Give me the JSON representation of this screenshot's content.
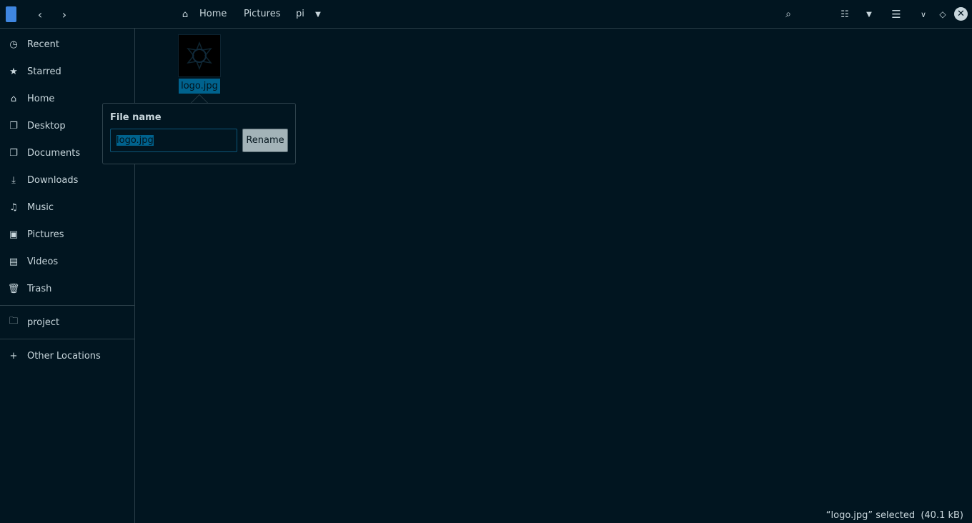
{
  "header": {
    "breadcrumbs": [
      "Home",
      "Pictures",
      "pi"
    ]
  },
  "sidebar": {
    "items": [
      {
        "label": "Recent",
        "icon": "clock-icon"
      },
      {
        "label": "Starred",
        "icon": "star-icon"
      },
      {
        "label": "Home",
        "icon": "home-icon"
      },
      {
        "label": "Desktop",
        "icon": "folder-icon"
      },
      {
        "label": "Documents",
        "icon": "folder-icon"
      },
      {
        "label": "Downloads",
        "icon": "download-icon"
      },
      {
        "label": "Music",
        "icon": "music-icon"
      },
      {
        "label": "Pictures",
        "icon": "image-icon"
      },
      {
        "label": "Videos",
        "icon": "film-icon"
      },
      {
        "label": "Trash",
        "icon": "trash-icon"
      }
    ],
    "bookmarks": [
      {
        "label": "project",
        "icon": "folder-icon"
      }
    ],
    "other": {
      "label": "Other Locations",
      "icon": "plus-icon"
    }
  },
  "files": [
    {
      "name": "logo.jpg",
      "selected": true
    }
  ],
  "rename_popover": {
    "title": "File name",
    "value": "logo.jpg",
    "button": "Rename"
  },
  "status": "“logo.jpg” selected  (40.1 kB)",
  "colors": {
    "background": "#011520",
    "selection": "#00628d",
    "text": "#c8d6dc"
  }
}
